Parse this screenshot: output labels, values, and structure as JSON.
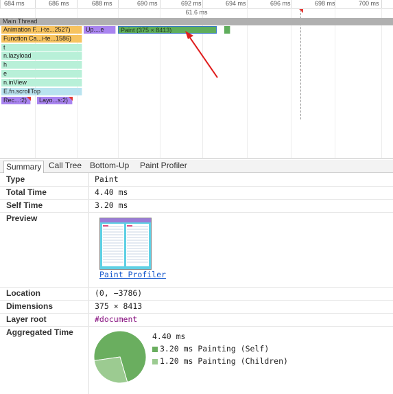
{
  "timeline": {
    "ticks": [
      "684 ms",
      "686 ms",
      "688 ms",
      "690 ms",
      "692 ms",
      "694 ms",
      "696 ms",
      "698 ms",
      "700 ms"
    ],
    "duration_label": "61.6 ms",
    "main_thread_label": "Main Thread",
    "colors": {
      "scripting_yellow": "#f7c35f",
      "rendering_purple": "#a984f0",
      "painting_green": "#5fad5c",
      "call_mint": "#b8f0d8",
      "call_blue": "#b9e3ef",
      "selection_blue": "#3778c8",
      "flag_red": "#e53935"
    },
    "bars": [
      {
        "label": "Animation F...i-te...2527)",
        "color": "#f7c35f"
      },
      {
        "label": "Up....e",
        "color": "#a984f0"
      },
      {
        "label": "Paint (375 × 8413)",
        "color": "#5fad5c"
      },
      {
        "label": "",
        "color": "#5fad5c"
      },
      {
        "label": "Function Ca...i-te...1586)",
        "color": "#f7c35f"
      },
      {
        "label": "t",
        "color": "#b8f0d8"
      },
      {
        "label": "n.lazyload",
        "color": "#b8f0d8"
      },
      {
        "label": "h",
        "color": "#b8f0d8"
      },
      {
        "label": "e",
        "color": "#b8f0d8"
      },
      {
        "label": "n.inView",
        "color": "#b8f0d8"
      },
      {
        "label": "E.fn.scrollTop",
        "color": "#b9e3ef"
      },
      {
        "label": "Rec...:2)",
        "color": "#a984f0"
      },
      {
        "label": "Layo...s:2)",
        "color": "#a984f0"
      }
    ]
  },
  "tabs": [
    {
      "label": "Summary",
      "active": true
    },
    {
      "label": "Call Tree",
      "active": false
    },
    {
      "label": "Bottom-Up",
      "active": false
    },
    {
      "label": "Paint Profiler",
      "active": false
    }
  ],
  "details": {
    "type": {
      "key": "Type",
      "value": "Paint"
    },
    "total_time": {
      "key": "Total Time",
      "value": "4.40 ms"
    },
    "self_time": {
      "key": "Self Time",
      "value": "3.20 ms"
    },
    "preview": {
      "key": "Preview",
      "link": "Paint Profiler"
    },
    "location": {
      "key": "Location",
      "value": "(0, −3786)"
    },
    "dimensions": {
      "key": "Dimensions",
      "value": "375 × 8413"
    },
    "layer_root": {
      "key": "Layer root",
      "value": "#document",
      "value_color": "#881280"
    },
    "aggregated": {
      "key": "Aggregated Time",
      "total": "4.40 ms",
      "items": [
        {
          "label": "3.20 ms Painting (Self)",
          "value_ms": 3.2,
          "color": "#6aae5f"
        },
        {
          "label": "1.20 ms Painting (Children)",
          "value_ms": 1.2,
          "color": "#9ccb91"
        }
      ]
    }
  }
}
